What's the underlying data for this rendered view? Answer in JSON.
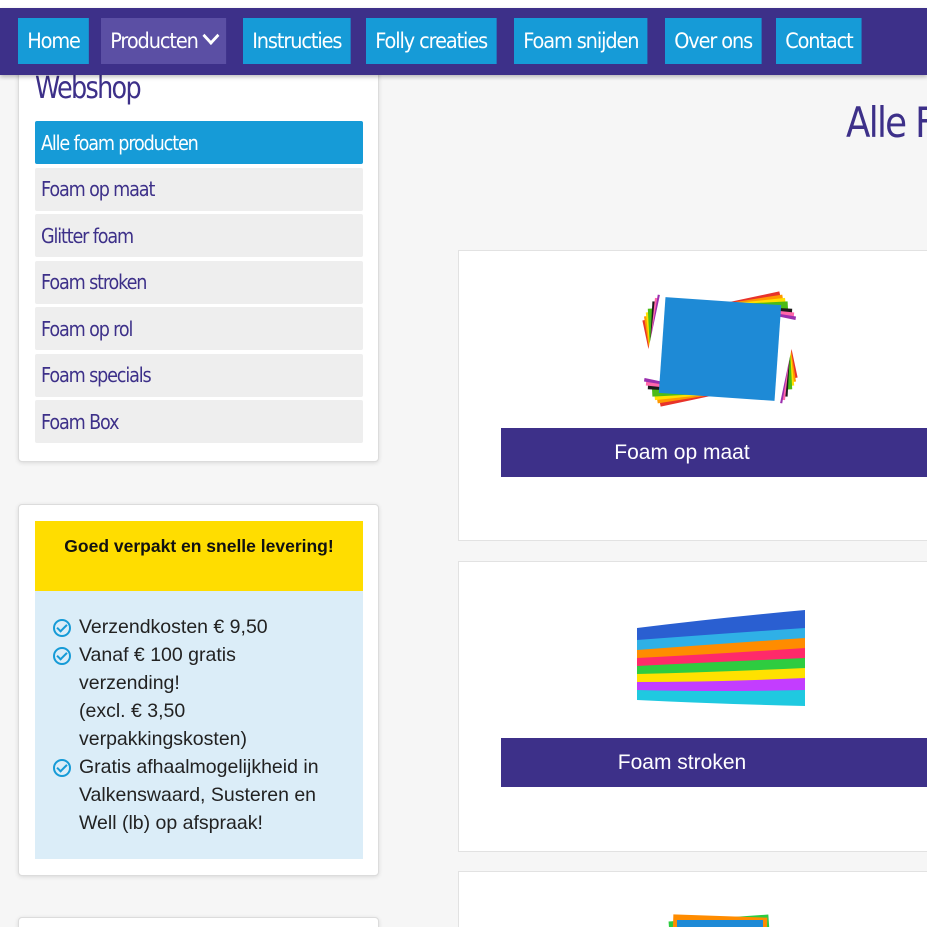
{
  "nav": {
    "items": [
      {
        "label": "Home"
      },
      {
        "label": "Producten"
      },
      {
        "label": "Instructies"
      },
      {
        "label": "Folly creaties"
      },
      {
        "label": "Foam snijden"
      },
      {
        "label": "Over ons"
      },
      {
        "label": "Contact"
      }
    ]
  },
  "sidebar": {
    "title": "Webshop",
    "categories": [
      {
        "label": "Alle foam producten"
      },
      {
        "label": "Foam op maat"
      },
      {
        "label": "Glitter foam"
      },
      {
        "label": "Foam stroken"
      },
      {
        "label": "Foam op rol"
      },
      {
        "label": "Foam specials"
      },
      {
        "label": "Foam Box"
      }
    ]
  },
  "shipping": {
    "heading": "Goed verpakt en snelle levering!",
    "lines": [
      {
        "text1": "Verzendkosten € 9,50"
      },
      {
        "text1": "Vanaf € 100 gratis",
        "text2": "verzending!",
        "text3": "(excl. € 3,50",
        "text4": "verpakkingskosten)"
      },
      {
        "text1": "Gratis afhaalmogelijkheid in",
        "text2": "Valkenswaard, Susteren en",
        "text3": "Well (lb) op afspraak!"
      }
    ]
  },
  "main": {
    "title": "Alle F",
    "products": [
      {
        "label": "Foam op maat",
        "image": "foam-sheets-image"
      },
      {
        "label": "Foam stroken",
        "image": "foam-strips-image"
      },
      {
        "label": "",
        "image": "foam-product-image"
      }
    ]
  },
  "colors": {
    "brand": "#3d3089",
    "accent": "#169bd7",
    "highlight": "#ffdd00",
    "info": "#dbedf8"
  }
}
